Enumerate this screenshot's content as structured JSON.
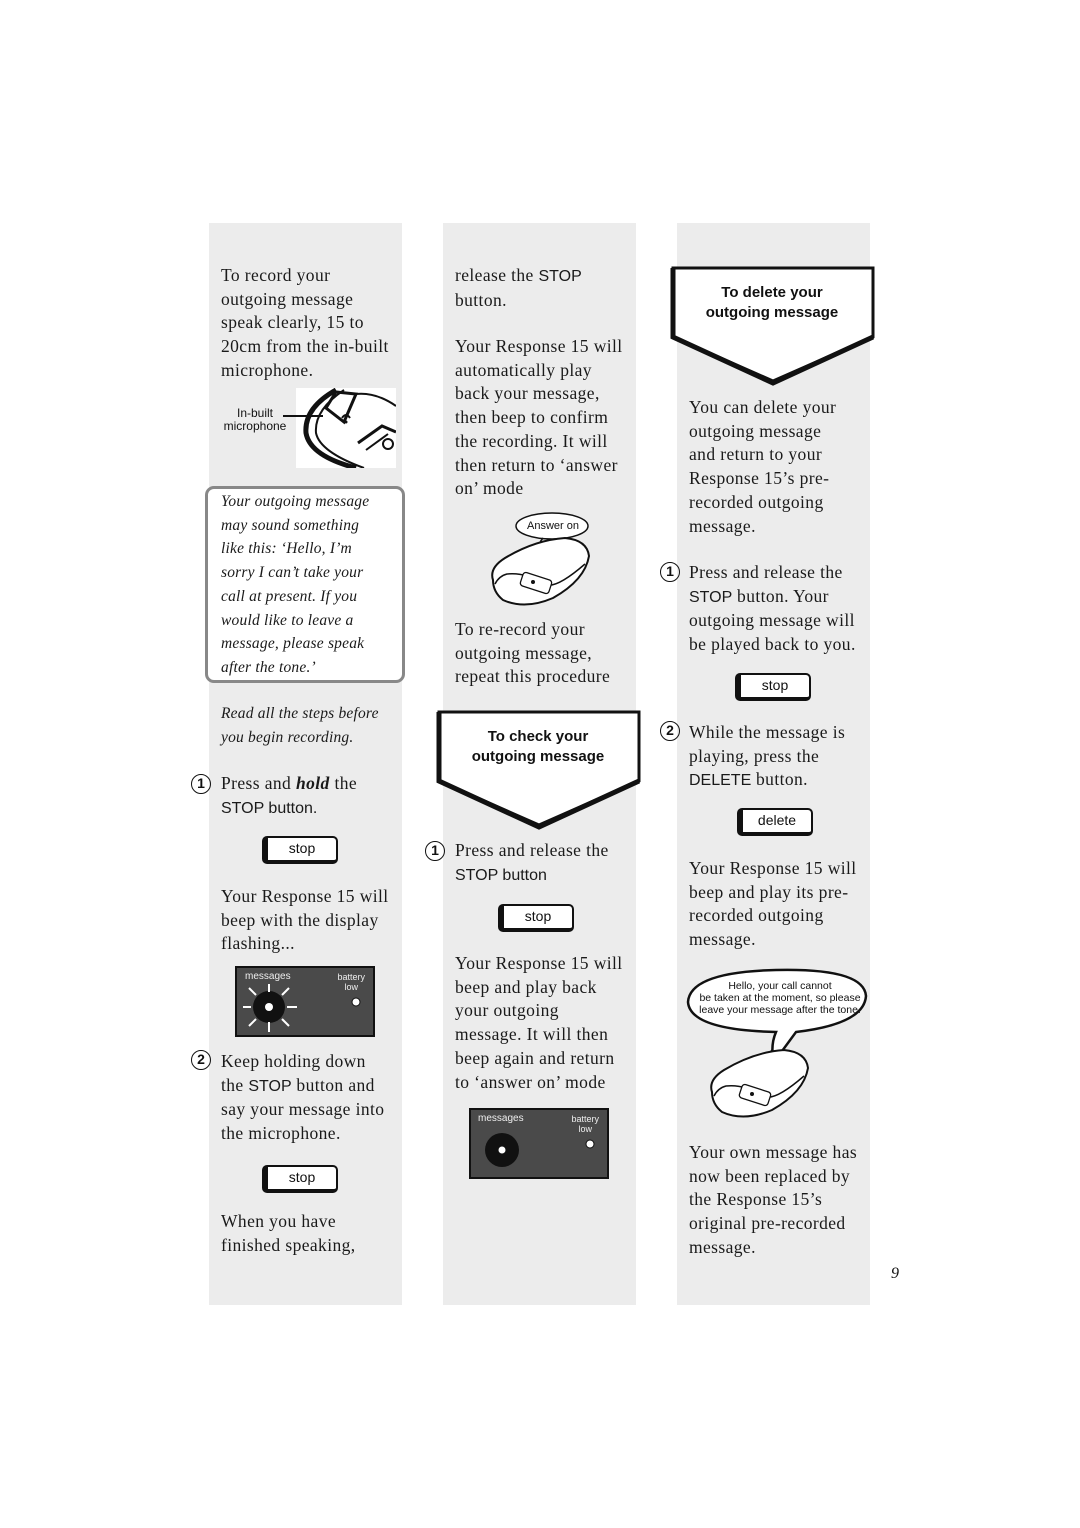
{
  "page": {
    "number": "9",
    "column_background": "#ececec"
  },
  "column1": {
    "intro": "To record your\noutgoing message\nspeak clearly, 15 to\n20cm from the in-built\nmicrophone.",
    "mic_label": "In-built\nmicrophone",
    "note": "Your outgoing message\nmay sound something\nlike this: ‘Hello, I’m\nsorry I can’t take your\ncall at present. If you\nwould like to leave a\nmessage, please speak\nafter the tone.’",
    "tip": "Read all the steps before\nyou begin recording.",
    "step1": {
      "number": "1",
      "text_pre": "Press and ",
      "text_em": "hold",
      "text_post": " the",
      "line2": "STOP button."
    },
    "stop_button_1": "stop",
    "after_step1": "Your Response 15 will\nbeep with the display\nflashing...",
    "display": {
      "messages_label": "messages",
      "battery_label": "battery\nlow",
      "state": "flashing"
    },
    "step2": {
      "number": "2",
      "line1": "Keep holding down",
      "line2_pre": "the ",
      "line2_sans": "STOP",
      "line2_post": " button and",
      "line3": "say your message into\nthe microphone."
    },
    "stop_button_2": "stop",
    "after_step2": "When you have\nfinished speaking,"
  },
  "column2": {
    "cont_pre": "release the ",
    "cont_sans": "STOP",
    "cont_line2": "button.",
    "playback": "Your Response 15 will\nautomatically play\nback your message,\nthen beep to confirm\nthe recording. It will\nthen return to ‘answer\non’ mode",
    "bubble": "Answer on",
    "rerecord": "To re-record your\noutgoing message,\nrepeat this procedure",
    "section_title": "To check your\noutgoing message",
    "step1": {
      "number": "1",
      "line1": "Press and release the",
      "line2": "STOP button"
    },
    "stop_button": "stop",
    "after_step1": "Your Response 15 will\nbeep and play back\nyour outgoing\nmessage.  It will then\nbeep again and return\nto ‘answer on’ mode",
    "display": {
      "messages_label": "messages",
      "battery_label": "battery\nlow",
      "state": "steady"
    }
  },
  "column3": {
    "section_title": "To delete your\noutgoing message",
    "intro": "You can delete your\noutgoing message\nand return to your\nResponse 15’s pre-\nrecorded outgoing\nmessage.",
    "step1": {
      "number": "1",
      "line1": "Press and release the",
      "line2_sans": "STOP",
      "line2_post": " button. Your",
      "line3": "outgoing message will\nbe played back to you."
    },
    "stop_button": "stop",
    "step2": {
      "number": "2",
      "line1": "While the message is\nplaying, press the",
      "line3_sans": "DELETE",
      "line3_post": " button."
    },
    "delete_button": "delete",
    "after_step2": "Your Response 15 will\nbeep and play its pre-\nrecorded outgoing\nmessage.",
    "bubble": "Hello, your call cannot\nbe taken at the moment, so please\nleave your message after the tone.",
    "outro": "Your own message has\nnow been replaced by\nthe Response 15’s\noriginal pre-recorded\nmessage."
  }
}
